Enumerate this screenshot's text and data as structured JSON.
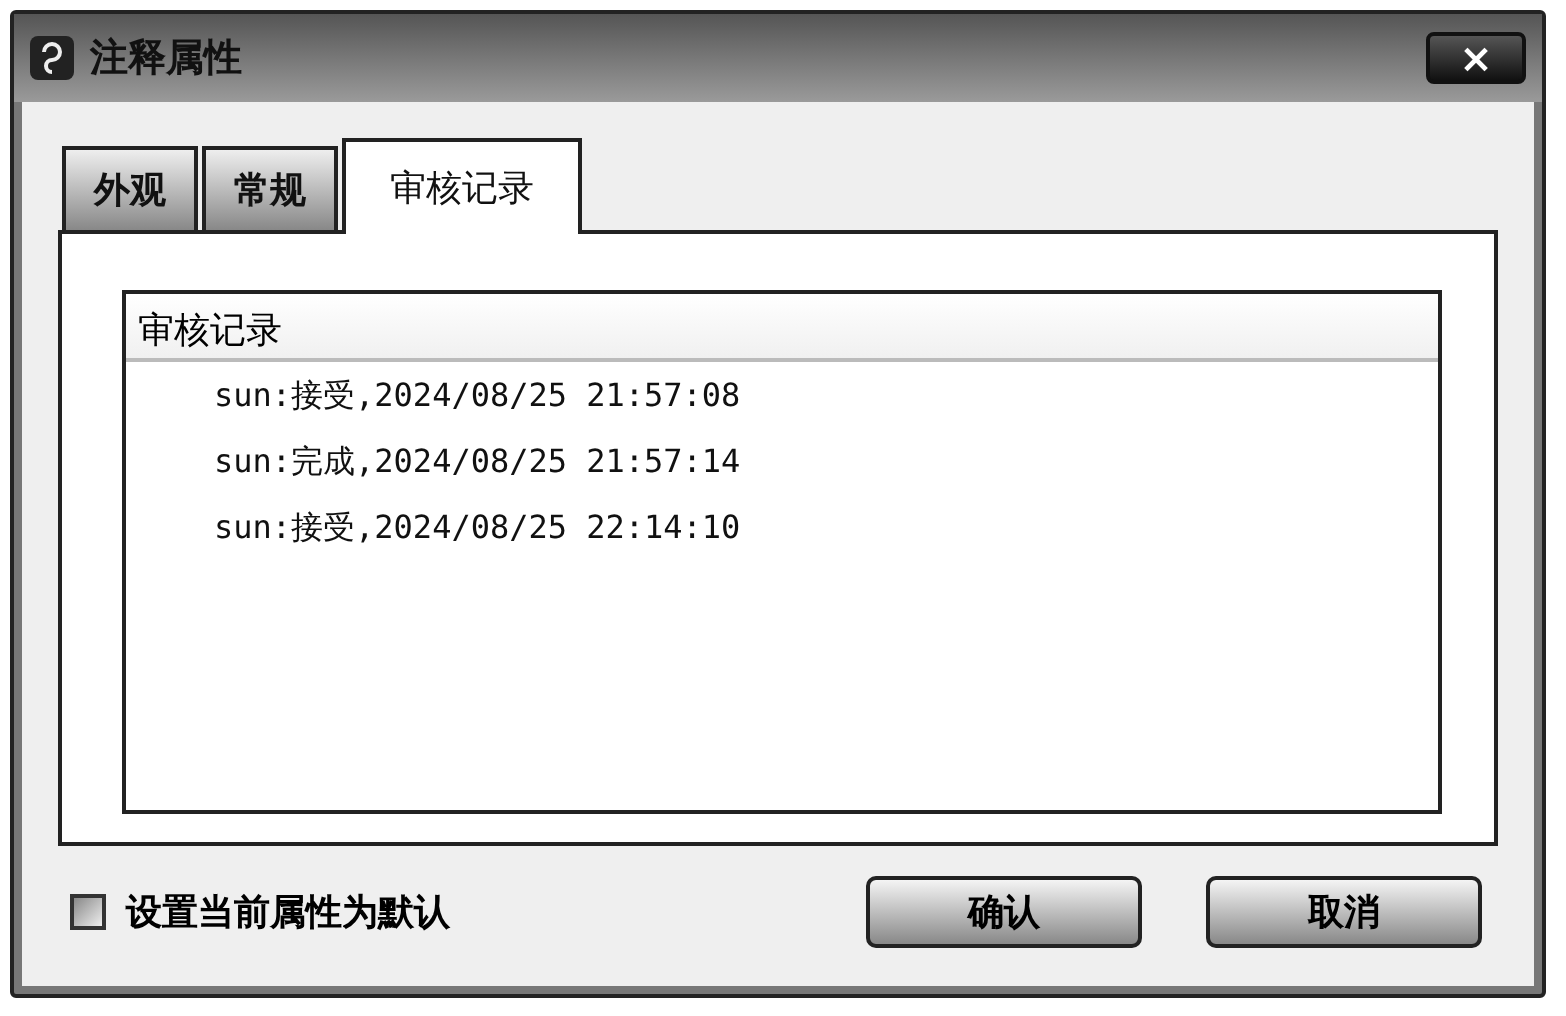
{
  "window": {
    "title": "注释属性",
    "close": "×"
  },
  "tabs": [
    {
      "label": "外观",
      "selected": false
    },
    {
      "label": "常规",
      "selected": false
    },
    {
      "label": "审核记录",
      "selected": true
    }
  ],
  "list": {
    "header": "审核记录",
    "rows": [
      "sun:接受,2024/08/25 21:57:08",
      "sun:完成,2024/08/25 21:57:14",
      "sun:接受,2024/08/25 22:14:10"
    ]
  },
  "default_checkbox": {
    "label": "设置当前属性为默认",
    "checked": false
  },
  "buttons": [
    "确认",
    "取消"
  ]
}
